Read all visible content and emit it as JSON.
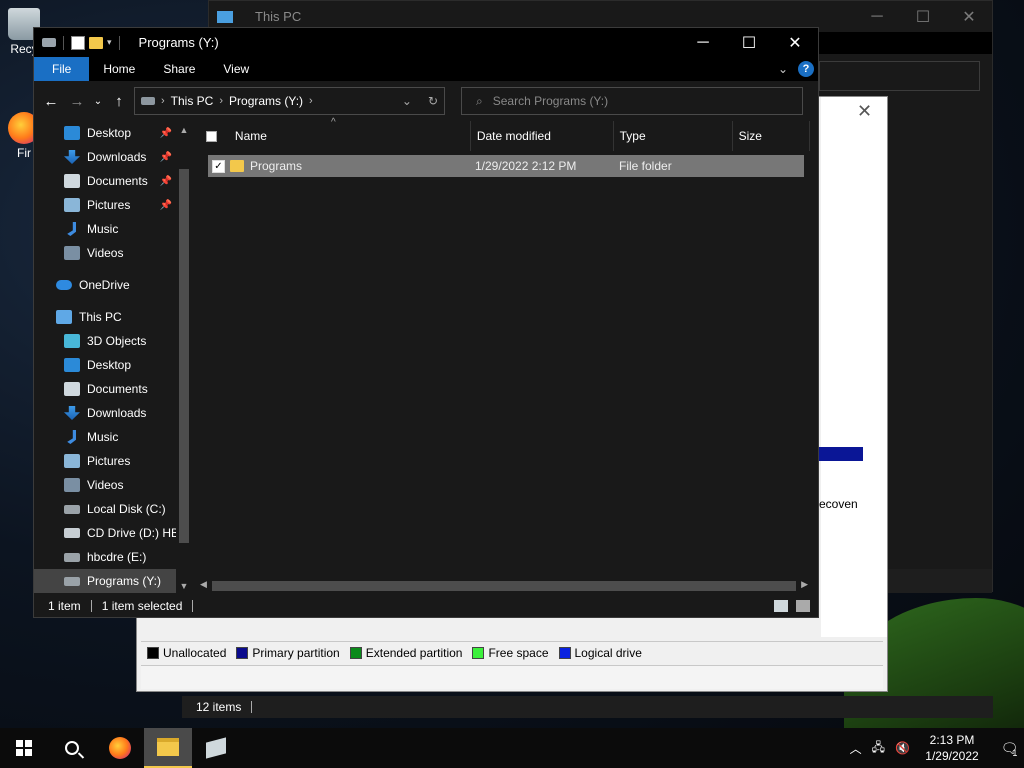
{
  "desktop": {
    "icons": [
      {
        "label": "Recy"
      },
      {
        "label": "Fir"
      }
    ]
  },
  "back_window": {
    "title": "This PC",
    "status": "12 items"
  },
  "disk_window": {
    "recover_text": "ecoven",
    "legend": [
      {
        "label": "Unallocated",
        "color": "#000000"
      },
      {
        "label": "Primary partition",
        "color": "#0a0a8c"
      },
      {
        "label": "Extended partition",
        "color": "#0a8a1a"
      },
      {
        "label": "Free space",
        "color": "#3cf03c"
      },
      {
        "label": "Logical drive",
        "color": "#0a22e0"
      }
    ]
  },
  "explorer": {
    "title": "Programs (Y:)",
    "ribbon": {
      "file": "File",
      "home": "Home",
      "share": "Share",
      "view": "View",
      "help": "?"
    },
    "address": {
      "root": "This PC",
      "current": "Programs (Y:)"
    },
    "search_placeholder": "Search Programs (Y:)",
    "nav": {
      "quick": [
        {
          "label": "Desktop",
          "icon": "desktop-icon",
          "pinned": true
        },
        {
          "label": "Downloads",
          "icon": "downloads-icon",
          "pinned": true
        },
        {
          "label": "Documents",
          "icon": "documents-icon",
          "pinned": true
        },
        {
          "label": "Pictures",
          "icon": "pictures-icon",
          "pinned": true
        },
        {
          "label": "Music",
          "icon": "music-icon",
          "pinned": false
        },
        {
          "label": "Videos",
          "icon": "videos-icon",
          "pinned": false
        }
      ],
      "onedrive": "OneDrive",
      "thispc": "This PC",
      "pc_items": [
        {
          "label": "3D Objects",
          "icon": "3d-objects-icon"
        },
        {
          "label": "Desktop",
          "icon": "desktop-icon"
        },
        {
          "label": "Documents",
          "icon": "documents-icon"
        },
        {
          "label": "Downloads",
          "icon": "downloads-icon"
        },
        {
          "label": "Music",
          "icon": "music-icon"
        },
        {
          "label": "Pictures",
          "icon": "pictures-icon"
        },
        {
          "label": "Videos",
          "icon": "videos-icon"
        },
        {
          "label": "Local Disk (C:)",
          "icon": "local-disk-icon"
        },
        {
          "label": "CD Drive (D:) HB",
          "icon": "cd-drive-icon"
        },
        {
          "label": "hbcdre (E:)",
          "icon": "drive-icon"
        },
        {
          "label": "Programs (Y:)",
          "icon": "drive-icon"
        }
      ]
    },
    "columns": {
      "name": "Name",
      "date": "Date modified",
      "type": "Type",
      "size": "Size"
    },
    "files": [
      {
        "name": "Programs",
        "date": "1/29/2022 2:12 PM",
        "type": "File folder",
        "size": ""
      }
    ],
    "status": {
      "count": "1 item",
      "selected": "1 item selected"
    }
  },
  "taskbar": {
    "time": "2:13 PM",
    "date": "1/29/2022",
    "notifications": "1"
  }
}
